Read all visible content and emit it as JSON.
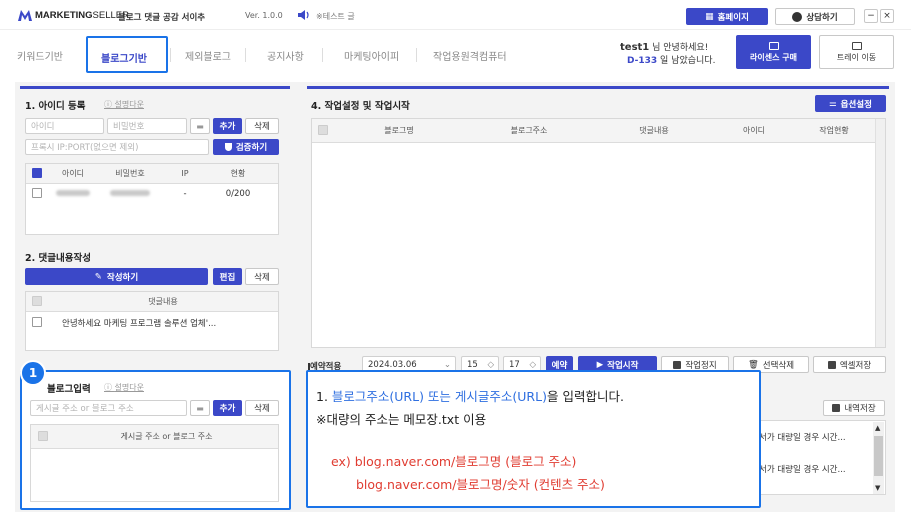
{
  "colors": {
    "accent": "#3b48c8",
    "annotation": "#1a73e8",
    "link_text": "#2f6fe0",
    "red_text": "#e03c31"
  },
  "titlebar": {
    "brand_bold": "MARKETING",
    "brand_light": "SELLER",
    "app_name": "블로그 댓글 공감 서이추",
    "version": "Ver. 1.0.0",
    "notice": "※테스트 글",
    "homepage_btn": "홈페이지",
    "consult_btn": "상담하기"
  },
  "tabs": [
    "키워드기반",
    "블로그기반",
    "제외블로그",
    "공지사항",
    "마케팅아이피",
    "작업용원격컴퓨터"
  ],
  "user": {
    "name": "test1",
    "greeting": "님 안녕하세요!",
    "dday": "D-133",
    "remaining": "일 남았습니다.",
    "license_btn": "라이센스 구매",
    "tray_btn": "트레이 이동"
  },
  "id_section": {
    "title": "1. 아이디 등록",
    "help": "설명다운",
    "id_placeholder": "아이디",
    "pw_placeholder": "비밀번호",
    "add": "추가",
    "delete": "삭제",
    "proxy_placeholder": "프록시 IP:PORT(없으면 제외)",
    "verify": "검증하기",
    "headers": [
      "아이디",
      "비밀번호",
      "IP",
      "현황"
    ],
    "row": {
      "ip": "-",
      "status": "0/200"
    }
  },
  "comment_section": {
    "title": "2. 댓글내용작성",
    "write": "작성하기",
    "edit": "편집",
    "delete": "삭제",
    "header": "댓글내용",
    "row": "안녕하세요 마케팅 프로그램 솔루션 업체'..."
  },
  "blog_section": {
    "title": "블로그입력",
    "help": "설명다운",
    "placeholder": "게시글 주소 or 블로그 주소",
    "add": "추가",
    "delete": "삭제",
    "header": "게시글 주소 or 블로그 주소"
  },
  "work_section": {
    "title": "4. 작업설정 및 작업시작",
    "options": "옵션설정",
    "headers": [
      "블로그명",
      "블로그주소",
      "댓글내용",
      "아이디",
      "작업현황"
    ],
    "reserve_label": "예약적용",
    "date": "2024.03.06",
    "hour": "15",
    "minute": "17",
    "reserve_btn": "예약",
    "start": "작업시작",
    "stop": "작업정지",
    "delete_sel": "선택삭제",
    "excel": "엑셀저장"
  },
  "log_section": {
    "save": "내역저장",
    "lines": [
      "서가 대량일 경우 시간...",
      "서가 대량일 경우 시간..."
    ]
  },
  "annotation": {
    "badge": "1",
    "line1_prefix": "1. ",
    "line1_link": "블로그주소(URL) 또는 게시글주소(URL)",
    "line1_suffix": "을 입력합니다.",
    "line2": "※대량의 주소는 메모장.txt 이용",
    "ex1": "ex) blog.naver.com/블로그명 (블로그 주소)",
    "ex2": "blog.naver.com/블로그명/숫자 (컨텐츠 주소)"
  }
}
